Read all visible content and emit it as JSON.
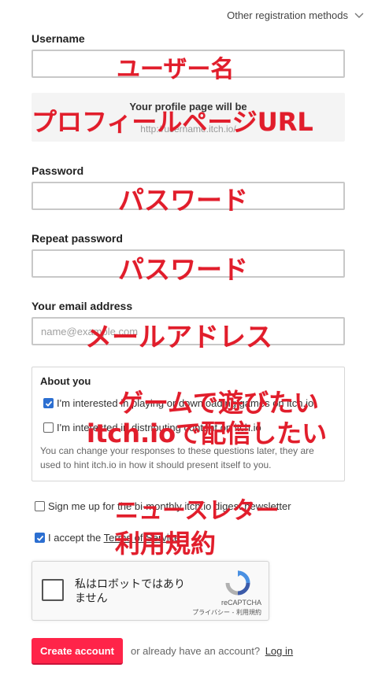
{
  "header": {
    "other_methods": "Other registration methods"
  },
  "username": {
    "label": "Username",
    "value": ""
  },
  "profile": {
    "title": "Your profile page will be",
    "url": "http://username.itch.io/"
  },
  "password": {
    "label": "Password"
  },
  "repeat_password": {
    "label": "Repeat password"
  },
  "email": {
    "label": "Your email address",
    "placeholder": "name@example.com"
  },
  "about": {
    "title": "About you",
    "options": [
      {
        "label": "I'm interested in playing or downloading games on itch.io",
        "checked": true
      },
      {
        "label": "I'm interested in distributing content on itch.io",
        "checked": false
      }
    ],
    "hint": "You can change your responses to these questions later, they are used to hint itch.io in how it should present itself to you."
  },
  "newsletter": {
    "label": "Sign me up for the bi-monthly itch.io digest newsletter",
    "checked": false
  },
  "terms": {
    "prefix": "I accept the ",
    "link": "Terms of Service",
    "checked": true
  },
  "recaptcha": {
    "text_line1": "私はロボットではあり",
    "text_line2": "ません",
    "brand": "reCAPTCHA",
    "privacy": "プライバシー",
    "separator": " - ",
    "terms": "利用規約"
  },
  "footer": {
    "create_button": "Create account",
    "already": "or already have an account?",
    "login_link": "Log in"
  },
  "annotations": {
    "username": "ユーザー名",
    "profile_url": "プロフィールページURL",
    "password": "パスワード",
    "repeat_password": "パスワード",
    "email": "メールアドレス",
    "play": "ゲームで遊びたい",
    "distribute": "itch.ioで配信したい",
    "newsletter": "ニュースレター",
    "terms": "利用規約"
  },
  "colors": {
    "accent": "#fa5c5c",
    "button": "#ff2449",
    "annotation": "#e11d2b",
    "checkbox": "#2c6fd1"
  }
}
